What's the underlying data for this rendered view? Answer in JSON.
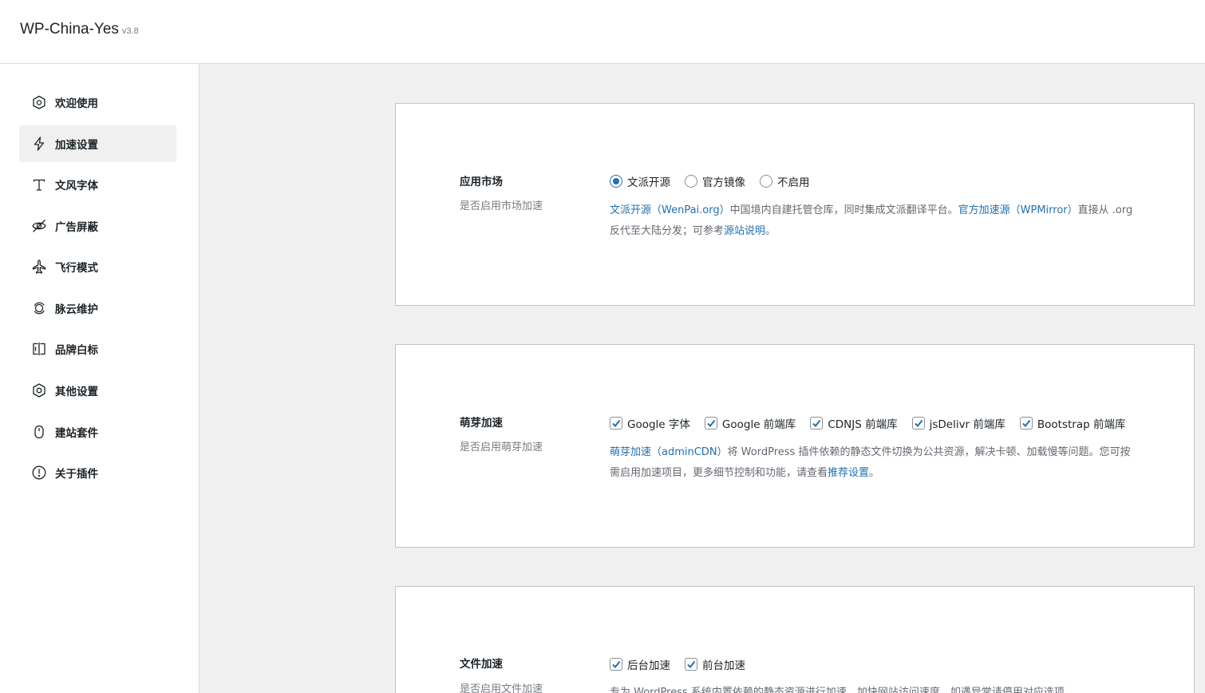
{
  "app": {
    "title": "WP-China-Yes",
    "version": "v3.8"
  },
  "sidebar": {
    "items": [
      {
        "label": "欢迎使用",
        "icon": "home-icon"
      },
      {
        "label": "加速设置",
        "icon": "lightning-icon",
        "active": true
      },
      {
        "label": "文风字体",
        "icon": "font-icon"
      },
      {
        "label": "广告屏蔽",
        "icon": "eye-off-icon"
      },
      {
        "label": "飞行模式",
        "icon": "airplane-icon"
      },
      {
        "label": "脉云维护",
        "icon": "cloud-refresh-icon"
      },
      {
        "label": "品牌白标",
        "icon": "brand-icon"
      },
      {
        "label": "其他设置",
        "icon": "settings-icon"
      },
      {
        "label": "建站套件",
        "icon": "mouse-icon"
      },
      {
        "label": "关于插件",
        "icon": "info-icon"
      }
    ]
  },
  "sections": {
    "market": {
      "title": "应用市场",
      "subtitle": "是否启用市场加速",
      "options": [
        "文派开源",
        "官方镜像",
        "不启用"
      ],
      "selected": "文派开源",
      "desc": {
        "link1": "文派开源（WenPai.org）",
        "text1": "中国境内自建托管仓库，同时集成文派翻译平台。",
        "link2": "官方加速源（WPMirror）",
        "text2": "直接从 .org 反代至大陆分发；可参考",
        "link3": "源站说明",
        "text3": "。"
      }
    },
    "cdn": {
      "title": "萌芽加速",
      "subtitle": "是否启用萌芽加速",
      "options": [
        "Google 字体",
        "Google 前端库",
        "CDNJS 前端库",
        "jsDelivr 前端库",
        "Bootstrap 前端库"
      ],
      "desc": {
        "link1": "萌芽加速（adminCDN）",
        "text1": "将 WordPress 插件依赖的静态文件切换为公共资源，解决卡顿、加载慢等问题。您可按需启用加速项目，更多细节控制和功能，请查看",
        "link2": "推荐设置",
        "text2": "。"
      }
    },
    "files": {
      "title": "文件加速",
      "subtitle": "是否启用文件加速",
      "options": [
        "后台加速",
        "前台加速"
      ],
      "desc": {
        "text1": "专为 WordPress 系统内置依赖的静态资源进行加速，加快网站访问速度，如遇异常请停用对应选项。"
      }
    }
  },
  "colors": {
    "accent": "#2271b1",
    "text": "#1d2327",
    "muted": "#787c82"
  }
}
